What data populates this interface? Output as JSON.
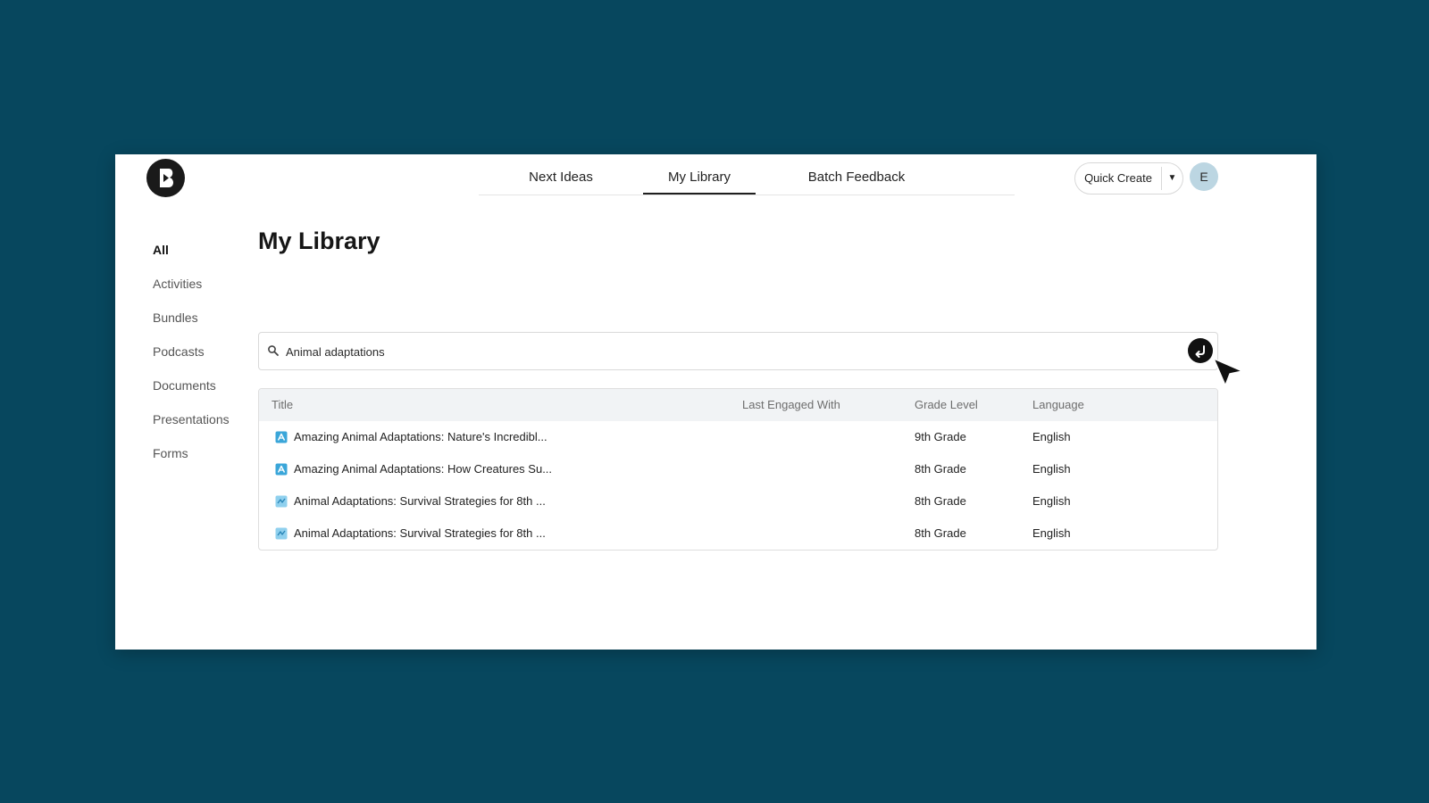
{
  "header": {
    "logo_icon": "brand-logo-icon",
    "tabs": [
      {
        "label": "Next Ideas",
        "active": false
      },
      {
        "label": "My Library",
        "active": true
      },
      {
        "label": "Batch Feedback",
        "active": false
      }
    ],
    "quick_create_label": "Quick Create",
    "quick_create_caret_icon": "caret-down-icon",
    "avatar_initial": "E"
  },
  "sidebar": {
    "items": [
      {
        "label": "All",
        "active": true
      },
      {
        "label": "Activities",
        "active": false
      },
      {
        "label": "Bundles",
        "active": false
      },
      {
        "label": "Podcasts",
        "active": false
      },
      {
        "label": "Documents",
        "active": false
      },
      {
        "label": "Presentations",
        "active": false
      },
      {
        "label": "Forms",
        "active": false
      }
    ]
  },
  "main": {
    "title": "My Library",
    "search": {
      "value": "Animal adaptations",
      "placeholder": "",
      "icon": "search-icon",
      "submit_icon": "enter-arrow-icon"
    },
    "table": {
      "columns": [
        "Title",
        "Last Engaged With",
        "Grade Level",
        "Language"
      ],
      "rows": [
        {
          "icon": "activity-icon",
          "title": "Amazing Animal Adaptations: Nature's Incredibl...",
          "last_engaged": "",
          "grade": "9th Grade",
          "language": "English"
        },
        {
          "icon": "activity-icon",
          "title": "Amazing Animal Adaptations: How Creatures Su...",
          "last_engaged": "",
          "grade": "8th Grade",
          "language": "English"
        },
        {
          "icon": "presentation-icon",
          "title": "Animal Adaptations: Survival Strategies for 8th ...",
          "last_engaged": "",
          "grade": "8th Grade",
          "language": "English"
        },
        {
          "icon": "presentation-icon",
          "title": "Animal Adaptations: Survival Strategies for 8th ...",
          "last_engaged": "",
          "grade": "8th Grade",
          "language": "English"
        }
      ]
    }
  },
  "colors": {
    "background": "#07475e",
    "accent_dark": "#111111",
    "avatar_bg": "#bcd6e2",
    "icon_blue": "#3aa6d9"
  },
  "cursor_icon": "mouse-pointer-icon"
}
